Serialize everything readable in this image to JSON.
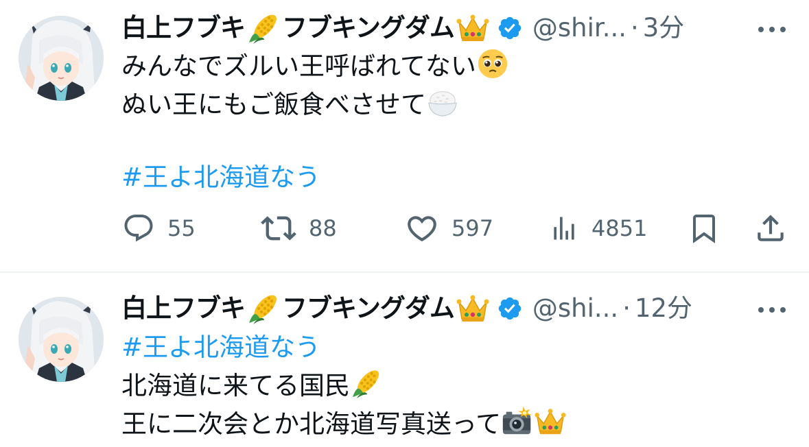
{
  "tweets": [
    {
      "author": {
        "display_name_part1": "白上フブキ",
        "display_name_part2": "フブキングダム",
        "name_emoji_1": "corn-emoji",
        "name_emoji_2": "crown-emoji",
        "verified": true,
        "handle": "@shir...",
        "separator": "·",
        "time": "3分"
      },
      "lines": [
        {
          "text": "みんなでズルい王呼ばれてない",
          "emoji": "pleading-face-emoji"
        },
        {
          "text": "ぬい王にもご飯食べさせて",
          "emoji": "rice-bowl-emoji"
        },
        {
          "text": "#王よ北海道なう",
          "hashtag": true
        }
      ],
      "stats": {
        "replies": "55",
        "retweets": "88",
        "likes": "597",
        "views": "4851"
      }
    },
    {
      "author": {
        "display_name_part1": "白上フブキ",
        "display_name_part2": "フブキングダム",
        "name_emoji_1": "corn-emoji",
        "name_emoji_2": "crown-emoji",
        "verified": true,
        "handle": "@shi...",
        "separator": "·",
        "time": "12分"
      },
      "lines": [
        {
          "text": "#王よ北海道なう",
          "hashtag": true
        },
        {
          "text": "北海道に来てる国民",
          "emoji": "corn-emoji"
        },
        {
          "text": "王に二次会とか北海道写真送って",
          "emoji": "camera-flash-emoji",
          "emoji2": "crown-emoji"
        }
      ]
    }
  ],
  "icons": {
    "more": "more-horizontal-icon",
    "reply": "reply-icon",
    "retweet": "retweet-icon",
    "like": "heart-icon",
    "views": "views-icon",
    "bookmark": "bookmark-icon",
    "share": "share-icon",
    "verified": "verified-badge-icon"
  },
  "colors": {
    "text": "#0f1419",
    "secondary": "#536471",
    "link": "#1d9bf0",
    "verified": "#1d9bf0",
    "divider": "#eff3f4"
  }
}
